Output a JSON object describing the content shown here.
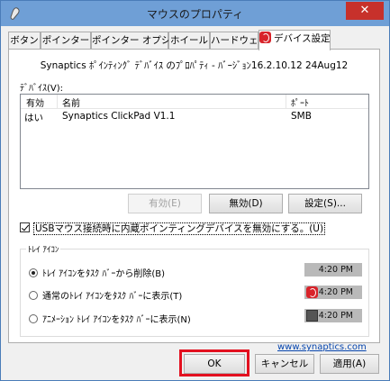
{
  "window": {
    "title": "マウスのプロパティ",
    "close_glyph": "✕"
  },
  "tabs": [
    {
      "label": "ボタン"
    },
    {
      "label": "ポインター"
    },
    {
      "label": "ポインター オプション"
    },
    {
      "label": "ホイール"
    },
    {
      "label": "ハードウェア"
    },
    {
      "label": "デバイス設定",
      "active": true
    }
  ],
  "panel": {
    "version_text": "Synaptics ﾎﾟｲﾝﾃｨﾝｸﾞ ﾃﾞﾊﾞｲｽ のﾌﾟﾛﾊﾟﾃｨ - ﾊﾞｰｼﾞｮﾝ16.2.10.12 24Aug12",
    "devices_label": "ﾃﾞﾊﾞｲｽ(V):",
    "device_columns": {
      "enabled": "有効",
      "name": "名前",
      "port": "ﾎﾟｰﾄ"
    },
    "devices": [
      {
        "enabled": "はい",
        "name": "Synaptics ClickPad V1.1",
        "port": "SMB"
      }
    ],
    "buttons": {
      "enable": "有効(E)",
      "disable": "無効(D)",
      "settings": "設定(S)..."
    },
    "disable_internal_checkbox": {
      "label": "USBマウス接続時に内蔵ポインティングデバイスを無効にする。(U)",
      "checked": true
    },
    "tray_group": {
      "title": "ﾄﾚｲ ｱｲｺﾝ",
      "options": [
        {
          "label": "ﾄﾚｲ ｱｲｺﾝをﾀｽｸ ﾊﾞｰから削除(B)",
          "selected": true,
          "preview_time": "4:20 PM",
          "preview_icon": "none"
        },
        {
          "label": "通常のﾄﾚｲ ｱｲｺﾝをﾀｽｸ ﾊﾞｰに表示(T)",
          "selected": false,
          "preview_time": "4:20 PM",
          "preview_icon": "synaptics-red-icon"
        },
        {
          "label": "ｱﾆﾒｰｼｮﾝ ﾄﾚｲ ｱｲｺﾝをﾀｽｸ ﾊﾞｰに表示(N)",
          "selected": false,
          "preview_time": "4:20 PM",
          "preview_icon": "animated-gray-icon"
        }
      ]
    },
    "link": "www.synaptics.com"
  },
  "footer": {
    "ok": "OK",
    "cancel": "キャンセル",
    "apply": "適用(A)"
  },
  "colors": {
    "accent_red": "#e3101f",
    "synaptics_red": "#d8232a",
    "link": "#0645ad"
  }
}
